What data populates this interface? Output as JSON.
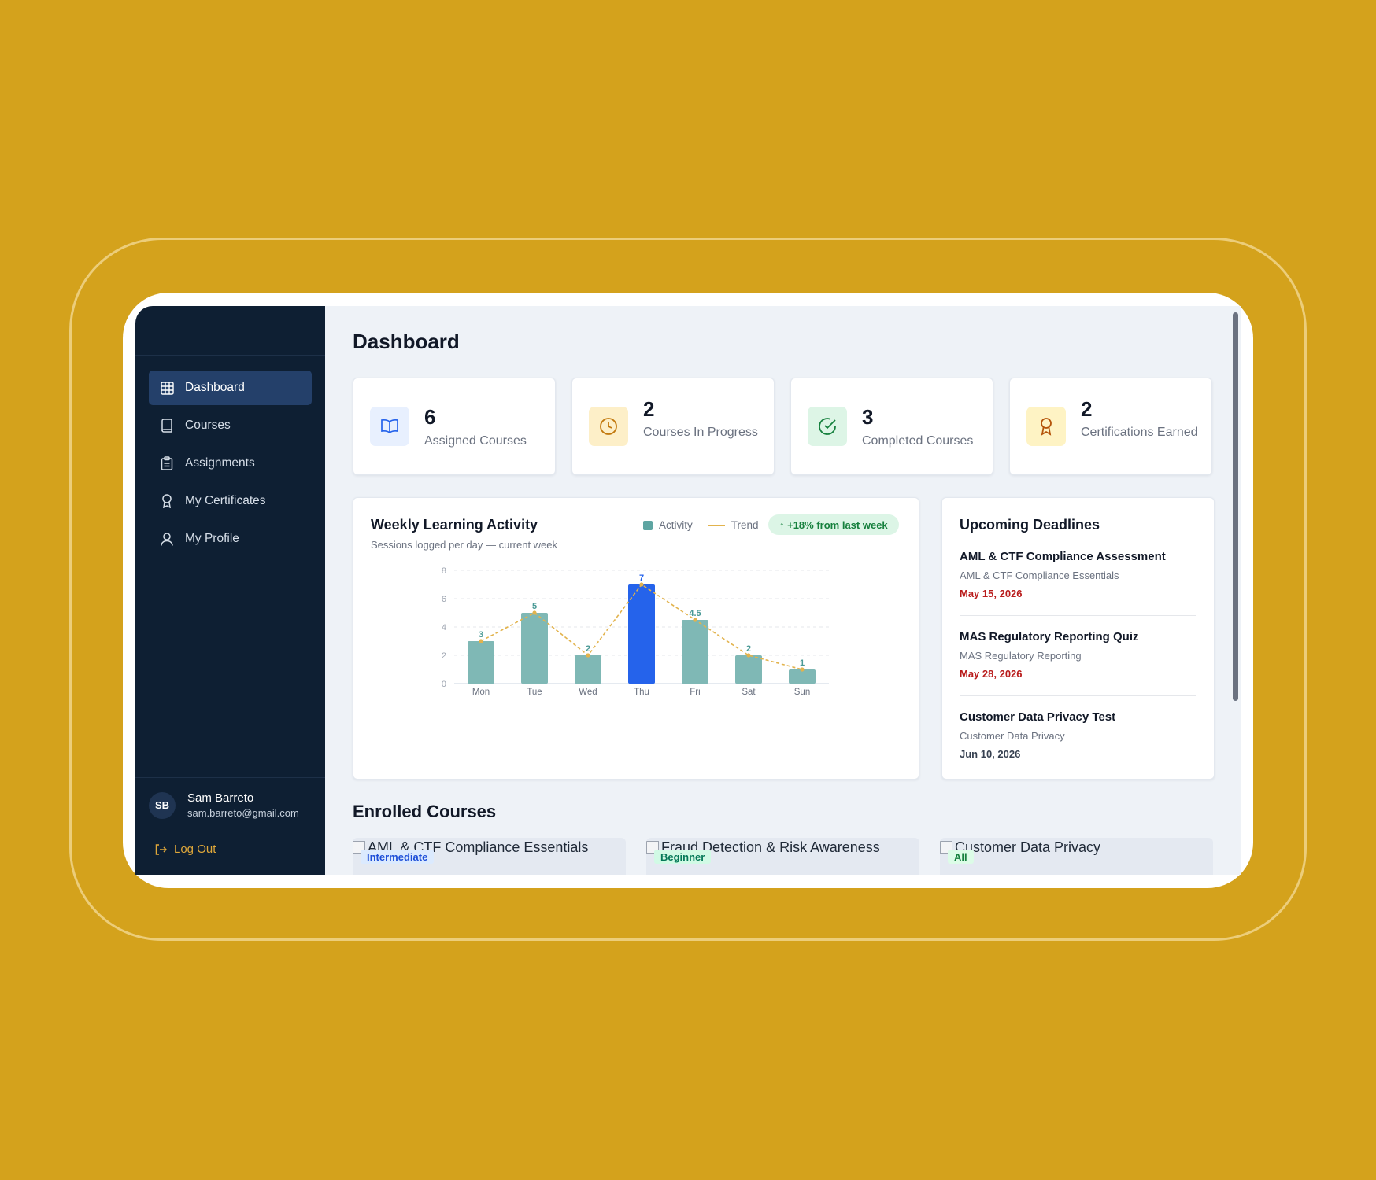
{
  "colors": {
    "background": "#D4A21C",
    "sidebar": "#0E1F33",
    "accent": "#2563EB",
    "teal": "#5EA5A2",
    "trend": "#E2B34D",
    "danger": "#B91C1C"
  },
  "sidebar": {
    "items": [
      {
        "label": "Dashboard",
        "icon": "grid-icon",
        "active": true
      },
      {
        "label": "Courses",
        "icon": "book-icon",
        "active": false
      },
      {
        "label": "Assignments",
        "icon": "clipboard-icon",
        "active": false
      },
      {
        "label": "My Certificates",
        "icon": "award-icon",
        "active": false
      },
      {
        "label": "My Profile",
        "icon": "user-icon",
        "active": false
      }
    ],
    "user": {
      "initials": "SB",
      "name": "Sam Barreto",
      "email": "sam.barreto@gmail.com"
    },
    "logout_label": "Log Out"
  },
  "main": {
    "title": "Dashboard",
    "stats": [
      {
        "value": "6",
        "label": "Assigned Courses",
        "icon": "book-open-icon"
      },
      {
        "value": "2",
        "label": "Courses In Progress",
        "icon": "clock-icon"
      },
      {
        "value": "3",
        "label": "Completed Courses",
        "icon": "check-circle-icon"
      },
      {
        "value": "2",
        "label": "Certifications Earned",
        "icon": "award-icon"
      }
    ],
    "activity": {
      "title": "Weekly Learning Activity",
      "subtitle": "Sessions logged per day — current week",
      "legend_activity": "Activity",
      "legend_trend": "Trend",
      "trend_badge": "↑ +18% from last week"
    },
    "deadlines": {
      "title": "Upcoming Deadlines",
      "items": [
        {
          "name": "AML & CTF Compliance Assessment",
          "course": "AML & CTF Compliance Essentials",
          "date": "May 15, 2026",
          "urgent": true
        },
        {
          "name": "MAS Regulatory Reporting Quiz",
          "course": "MAS Regulatory Reporting",
          "date": "May 28, 2026",
          "urgent": true
        },
        {
          "name": "Customer Data Privacy Test",
          "course": "Customer Data Privacy",
          "date": "Jun 10, 2026",
          "urgent": false
        }
      ]
    },
    "enrolled": {
      "title": "Enrolled Courses",
      "courses": [
        {
          "name": "AML & CTF Compliance Essentials",
          "level": "Intermediate"
        },
        {
          "name": "Fraud Detection & Risk Awareness",
          "level": "Beginner"
        },
        {
          "name": "Customer Data Privacy",
          "level": "All"
        }
      ]
    }
  },
  "chart_data": {
    "type": "bar",
    "categories": [
      "Mon",
      "Tue",
      "Wed",
      "Thu",
      "Fri",
      "Sat",
      "Sun"
    ],
    "values": [
      3,
      5,
      2,
      7,
      4.5,
      2,
      1
    ],
    "value_labels": [
      "3",
      "5",
      "2",
      "7",
      "4.5",
      "2",
      "1"
    ],
    "highlight_index": 3,
    "trend_values": [
      3,
      5,
      2,
      7,
      4.5,
      2,
      1
    ],
    "ylim": [
      0,
      8
    ],
    "yticks": [
      "0",
      "2",
      "4",
      "6",
      "8"
    ],
    "grid": true
  }
}
